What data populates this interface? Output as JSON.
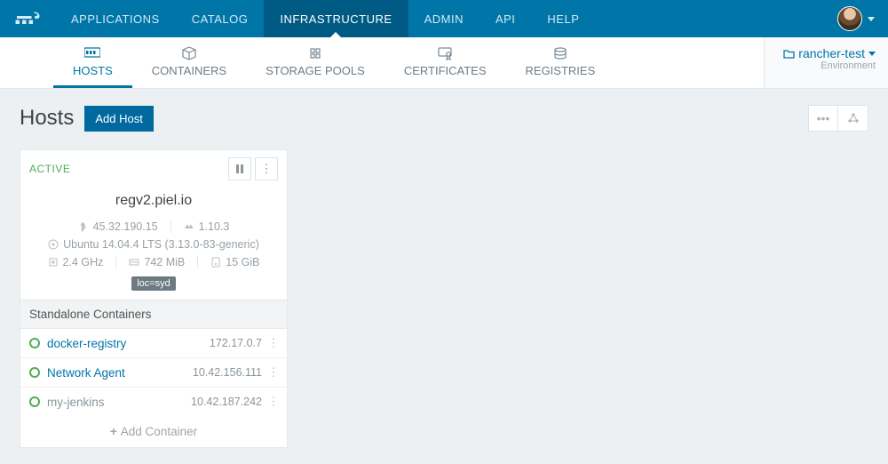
{
  "top_nav": {
    "applications": "APPLICATIONS",
    "catalog": "CATALOG",
    "infrastructure": "INFRASTRUCTURE",
    "admin": "ADMIN",
    "api": "API",
    "help": "HELP"
  },
  "sub_nav": {
    "hosts": "HOSTS",
    "containers": "CONTAINERS",
    "storage_pools": "STORAGE POOLS",
    "certificates": "CERTIFICATES",
    "registries": "REGISTRIES"
  },
  "env": {
    "name": "rancher-test",
    "label": "Environment"
  },
  "page": {
    "title": "Hosts",
    "add_button": "Add Host"
  },
  "host": {
    "status": "ACTIVE",
    "name": "regv2.piel.io",
    "ip": "45.32.190.15",
    "docker": "1.10.3",
    "os": "Ubuntu 14.04.4 LTS (3.13.0-83-generic)",
    "cpu": "2.4 GHz",
    "mem": "742 MiB",
    "disk": "15 GiB",
    "tag": "loc=syd"
  },
  "containers": {
    "header": "Standalone Containers",
    "items": [
      {
        "name": "docker-registry",
        "ip": "172.17.0.7",
        "link": true
      },
      {
        "name": "Network Agent",
        "ip": "10.42.156.111",
        "link": true
      },
      {
        "name": "my-jenkins",
        "ip": "10.42.187.242",
        "link": false
      }
    ],
    "add_label": "Add Container"
  }
}
